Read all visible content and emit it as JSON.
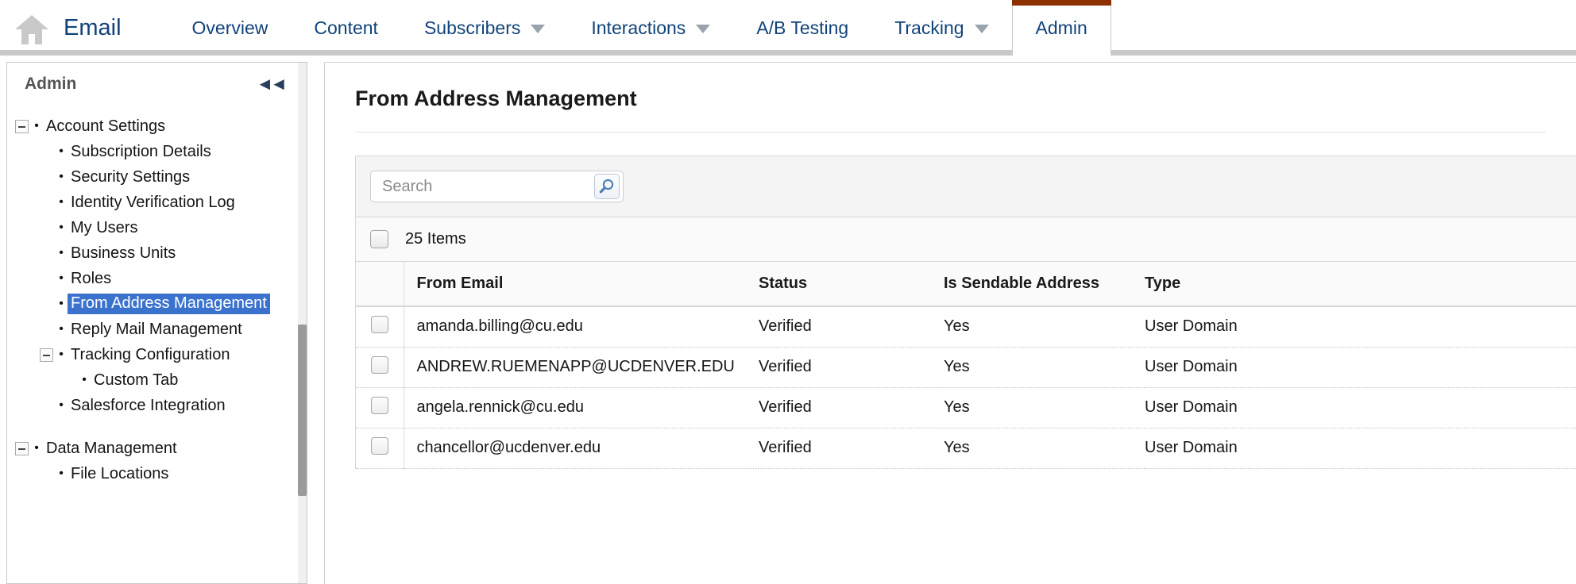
{
  "topnav": {
    "home_icon": "home-icon",
    "app_title": "Email",
    "items": [
      {
        "label": "Overview",
        "caret": false,
        "active": false
      },
      {
        "label": "Content",
        "caret": false,
        "active": false
      },
      {
        "label": "Subscribers",
        "caret": true,
        "active": false
      },
      {
        "label": "Interactions",
        "caret": true,
        "active": false
      },
      {
        "label": "A/B Testing",
        "caret": false,
        "active": false
      },
      {
        "label": "Tracking",
        "caret": true,
        "active": false
      },
      {
        "label": "Admin",
        "caret": false,
        "active": true
      }
    ],
    "active_tab_accent": "#8c3000",
    "link_color": "#11437a"
  },
  "sidebar": {
    "title": "Admin",
    "collapse_icon": "double-chevron-left-icon",
    "selected_item": "From Address Management",
    "selection_color": "#3a72cd",
    "tree": [
      {
        "label": "Account Settings",
        "level": 0,
        "toggle": "minus"
      },
      {
        "label": "Subscription Details",
        "level": 1,
        "toggle": "none"
      },
      {
        "label": "Security Settings",
        "level": 1,
        "toggle": "none"
      },
      {
        "label": "Identity Verification Log",
        "level": 1,
        "toggle": "none"
      },
      {
        "label": "My Users",
        "level": 1,
        "toggle": "none"
      },
      {
        "label": "Business Units",
        "level": 1,
        "toggle": "none"
      },
      {
        "label": "Roles",
        "level": 1,
        "toggle": "none"
      },
      {
        "label": "From Address Management",
        "level": 1,
        "toggle": "none",
        "selected": true
      },
      {
        "label": "Reply Mail Management",
        "level": 1,
        "toggle": "none"
      },
      {
        "label": "Tracking Configuration",
        "level": 1,
        "toggle": "minus"
      },
      {
        "label": "Custom Tab",
        "level": 2,
        "toggle": "none"
      },
      {
        "label": "Salesforce Integration",
        "level": 1,
        "toggle": "none"
      },
      {
        "label": "Data Management",
        "level": 0,
        "toggle": "minus",
        "gap_before": true
      },
      {
        "label": "File Locations",
        "level": 1,
        "toggle": "none"
      }
    ]
  },
  "main": {
    "page_title": "From Address Management",
    "search": {
      "value": "",
      "placeholder": "Search",
      "button_icon": "search-magnifier-icon"
    },
    "items_label": "25 Items",
    "table": {
      "columns": [
        "From Email",
        "Status",
        "Is Sendable Address",
        "Type"
      ],
      "rows": [
        {
          "email": "amanda.billing@cu.edu",
          "status": "Verified",
          "sendable": "Yes",
          "type": "User Domain"
        },
        {
          "email": "ANDREW.RUEMENAPP@UCDENVER.EDU",
          "status": "Verified",
          "sendable": "Yes",
          "type": "User Domain"
        },
        {
          "email": "angela.rennick@cu.edu",
          "status": "Verified",
          "sendable": "Yes",
          "type": "User Domain"
        },
        {
          "email": "chancellor@ucdenver.edu",
          "status": "Verified",
          "sendable": "Yes",
          "type": "User Domain"
        }
      ]
    }
  }
}
